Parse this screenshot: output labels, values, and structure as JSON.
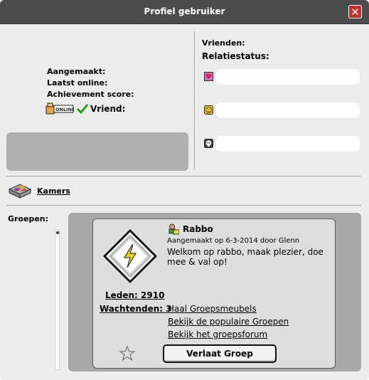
{
  "window": {
    "title": "Profiel gebruiker",
    "close_glyph": "✕"
  },
  "profile": {
    "created_label": "Aangemaakt:",
    "last_online_label": "Laatst online:",
    "achievement_label": "Achievement score:",
    "online_badge": "ONLINE",
    "friend_label": "Vriend:"
  },
  "relations": {
    "friends_label": "Vrienden:",
    "status_label": "Relatiestatus:",
    "items": [
      {
        "icon": "heart-icon",
        "value": ""
      },
      {
        "icon": "smiley-icon",
        "value": ""
      },
      {
        "icon": "skull-icon",
        "value": ""
      }
    ]
  },
  "rooms": {
    "label": "Kamers"
  },
  "groups": {
    "label": "Groepen:",
    "members": "Leden: 2910",
    "pending": "Wachtenden: 3",
    "name": "Rabbo",
    "created": "Aangemaakt op 6-3-2014 door Glenn",
    "description": "Welkom op rabbo, maak plezier, doe mee & val op!",
    "links": [
      "Haal Groepsmeubels",
      "Bekijk de populaire Groepen",
      "Bekijk het groepsforum"
    ],
    "leave_button": "Verlaat Groep",
    "badge_small": "SGR"
  },
  "colors": {
    "titlebar": "#4c4c4c",
    "close": "#c3302a",
    "panel": "#ececec",
    "group_panel": "#a8a8a8"
  }
}
